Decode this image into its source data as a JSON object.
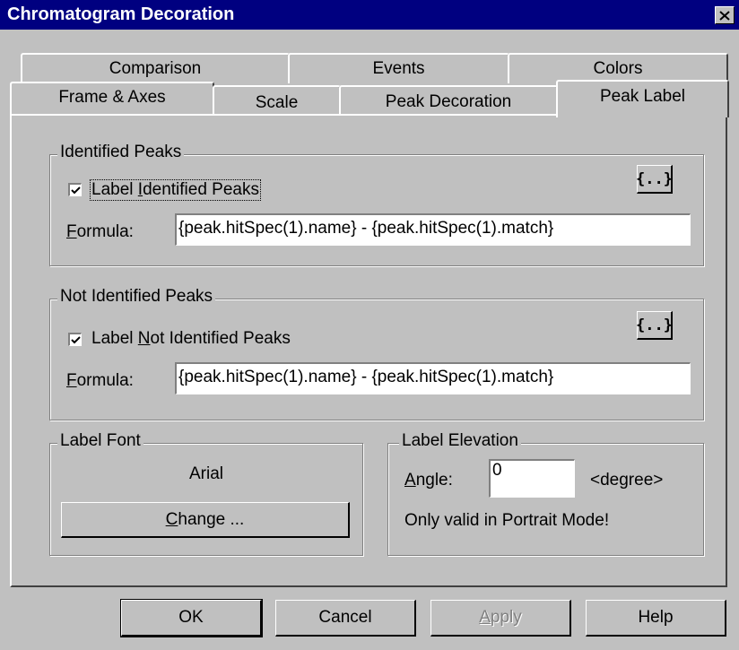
{
  "window": {
    "title": "Chromatogram Decoration",
    "close_icon": "close-icon"
  },
  "tabs_back": [
    {
      "label": "Comparison"
    },
    {
      "label": "Events"
    },
    {
      "label": "Colors"
    }
  ],
  "tabs_front": [
    {
      "label": "Frame & Axes"
    },
    {
      "label": "Scale"
    },
    {
      "label": "Peak Decoration"
    },
    {
      "label": "Peak Label",
      "active": true
    }
  ],
  "identified": {
    "group_label": "Identified Peaks",
    "checkbox_label_pre": "Label ",
    "checkbox_label_mnemonic": "I",
    "checkbox_label_post": "dentified Peaks",
    "checked": true,
    "formula_label_mnemonic": "F",
    "formula_label_rest": "ormula:",
    "formula_value": "{peak.hitSpec(1).name} - {peak.hitSpec(1).match}",
    "insert_button_label": "{..}"
  },
  "not_identified": {
    "group_label": "Not Identified Peaks",
    "checkbox_label_pre": "Label ",
    "checkbox_label_mnemonic": "N",
    "checkbox_label_post": "ot Identified Peaks",
    "checked": true,
    "formula_label_mnemonic": "F",
    "formula_label_rest": "ormula:",
    "formula_value": "{peak.hitSpec(1).name} - {peak.hitSpec(1).match}",
    "insert_button_label": "{..}"
  },
  "label_font": {
    "group_label": "Label Font",
    "font_name": "Arial",
    "change_mnemonic": "C",
    "change_rest": "hange ..."
  },
  "label_elevation": {
    "group_label": "Label Elevation",
    "angle_mnemonic": "A",
    "angle_rest": "ngle:",
    "angle_value": "0",
    "unit": "<degree>",
    "note": "Only valid in Portrait Mode!"
  },
  "buttons": {
    "ok": "OK",
    "cancel": "Cancel",
    "apply_mnemonic": "A",
    "apply_rest": "pply",
    "help": "Help"
  },
  "colors": {
    "titlebar": "#000080",
    "face": "#c0c0c0"
  }
}
